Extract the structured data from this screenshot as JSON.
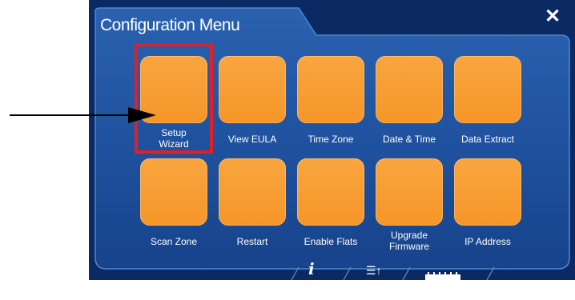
{
  "dialog": {
    "title": "Configuration Menu",
    "close_symbol": "✕"
  },
  "tiles": [
    {
      "label": "Setup\nWizard",
      "highlighted": true
    },
    {
      "label": "View EULA"
    },
    {
      "label": "Time Zone"
    },
    {
      "label": "Date & Time"
    },
    {
      "label": "Data Extract"
    },
    {
      "label": "Scan Zone"
    },
    {
      "label": "Restart"
    },
    {
      "label": "Enable Flats"
    },
    {
      "label": "Upgrade\nFirmware"
    },
    {
      "label": "IP Address"
    }
  ],
  "toolbar": {
    "info_symbol": "i",
    "list_symbol": "☰↑"
  },
  "colors": {
    "background": "#0b2a63",
    "panel": "#1e4f9a",
    "tile": "#f79a2e",
    "highlight": "#e21e26"
  },
  "icons": [
    "close-icon",
    "info-icon",
    "list-icon",
    "ruler-icon",
    "arrow-pointer"
  ]
}
